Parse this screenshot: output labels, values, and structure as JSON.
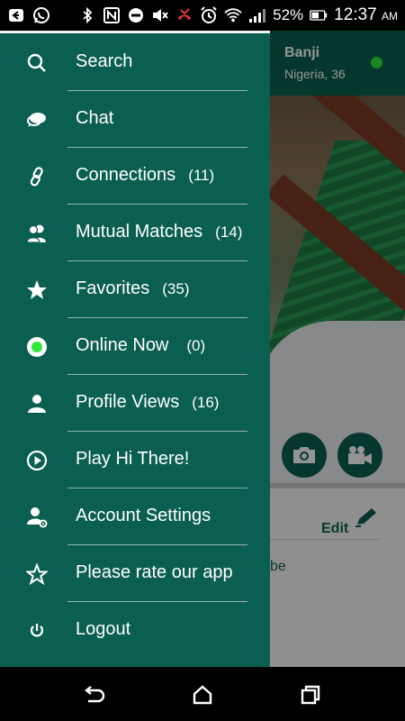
{
  "status_bar": {
    "battery_percent": "52%",
    "time": "12:37",
    "ampm": "AM",
    "icons": [
      "notification-icon",
      "whatsapp-icon",
      "bluetooth-icon",
      "nfc-icon",
      "do-not-disturb-icon",
      "mute-icon",
      "missed-call-icon",
      "alarm-icon",
      "wifi-icon",
      "signal-icon",
      "battery-icon"
    ]
  },
  "profile": {
    "name": "Banji",
    "location": "Nigeria, 36",
    "edit_label": "Edit",
    "detail_fragment": "be"
  },
  "menu": {
    "items": [
      {
        "label": "Search",
        "count": "",
        "icon": "search-icon"
      },
      {
        "label": "Chat",
        "count": "",
        "icon": "chat-icon"
      },
      {
        "label": "Connections",
        "count": "(11)",
        "icon": "link-icon"
      },
      {
        "label": "Mutual Matches",
        "count": "(14)",
        "icon": "users-icon"
      },
      {
        "label": "Favorites",
        "count": "(35)",
        "icon": "star-icon"
      },
      {
        "label": "Online Now",
        "count": "(0)",
        "icon": "online-icon"
      },
      {
        "label": "Profile Views",
        "count": "(16)",
        "icon": "person-icon"
      },
      {
        "label": "Play Hi There!",
        "count": "",
        "icon": "play-icon"
      },
      {
        "label": "Account Settings",
        "count": "",
        "icon": "user-settings-icon"
      },
      {
        "label": "Please rate our app",
        "count": "",
        "icon": "star-outline-icon"
      },
      {
        "label": "Logout",
        "count": "",
        "icon": "power-icon"
      }
    ]
  },
  "colors": {
    "primary": "#0b5f50",
    "online_green": "#2ee83a",
    "text": "#ffffff"
  }
}
